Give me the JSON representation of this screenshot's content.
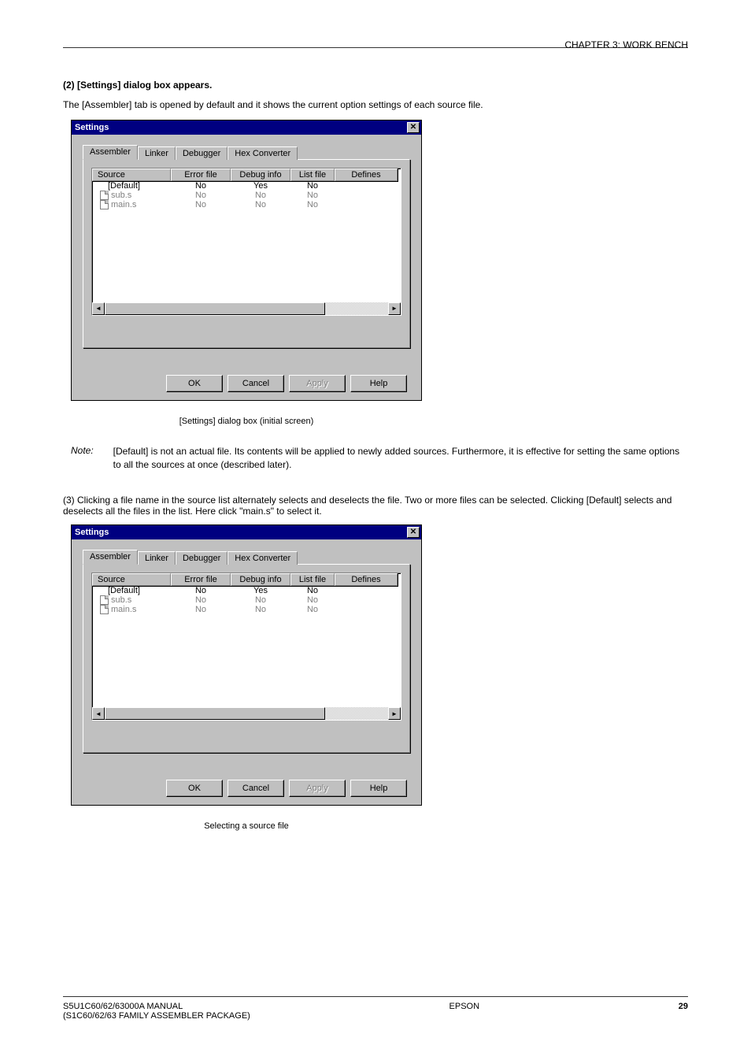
{
  "header": {
    "chapter": "CHAPTER 3: WORK BENCH"
  },
  "section1": {
    "num": "(2) [Settings] dialog box appears.",
    "desc": "The [Assembler] tab is opened by default and it shows the current option settings of each source file."
  },
  "dialog": {
    "title": "Settings",
    "tabs": [
      "Assembler",
      "Linker",
      "Debugger",
      "Hex Converter"
    ],
    "columns": [
      "Source",
      "Error file",
      "Debug info",
      "List file",
      "Defines"
    ],
    "rows": [
      {
        "source": "[Default]",
        "error": "No",
        "debug": "Yes",
        "list": "No",
        "defines": "",
        "type": "default"
      },
      {
        "source": "sub.s",
        "error": "No",
        "debug": "No",
        "list": "No",
        "defines": "",
        "type": "file"
      },
      {
        "source": "main.s",
        "error": "No",
        "debug": "No",
        "list": "No",
        "defines": "",
        "type": "file"
      }
    ],
    "buttons": {
      "ok": "OK",
      "cancel": "Cancel",
      "apply": "Apply",
      "help": "Help"
    }
  },
  "caption1": "[Settings] dialog box (initial screen)",
  "noteLabel": "Note:",
  "noteBody": "[Default] is not an actual file. Its contents will be applied to newly added sources. Furthermore, it is effective for setting the same options to all the sources at once (described later).",
  "section2": {
    "num": "(3) Clicking a file name in the source list alternately selects and deselects the file. Two or more files can be selected. Clicking [Default] selects and deselects all the files in the list. Here click \"main.s\" to select it."
  },
  "caption2": "Selecting a source file",
  "footer": {
    "left": "S5U1C60/62/63000A MANUAL",
    "center": "EPSON",
    "right": "29",
    "sub": "(S1C60/62/63 FAMILY ASSEMBLER PACKAGE)"
  }
}
